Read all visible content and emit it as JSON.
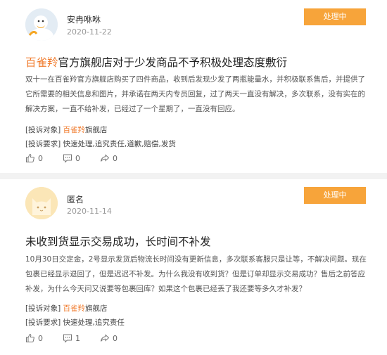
{
  "posts": [
    {
      "username": "安冉咻咻",
      "date": "2020-11-22",
      "status": "处理中",
      "title_brand": "百雀羚",
      "title_rest": "官方旗舰店对于少发商品不予积极处理态度敷衍",
      "body": "双十一在百雀羚官方旗舰店购买了四件商品，收到后发现少发了两瓶能量水，并积极联系售后，并提供了它所需要的相关信息和图片，并承诺在两天内专员回复，过了两天一直没有解决，多次联系，没有实在的解决方案，一直不给补发，已经过了一个星期了，一直没有回应。",
      "complaint_object_label": "[投诉对象]",
      "complaint_object_brand": "百雀羚",
      "complaint_object_rest": "旗舰店",
      "complaint_request_label": "[投诉要求]",
      "complaint_request": "快速处理,追究责任,道歉,赔偿,发货",
      "likes": "0",
      "comments": "0",
      "shares": "0"
    },
    {
      "username": "匿名",
      "date": "2020-11-14",
      "status": "处理中",
      "title_brand": "",
      "title_rest": "未收到货显示交易成功，长时间不补发",
      "body": "10月30日交定金，2号显示发货后物流长时间没有更新信息，多次联系客服只是让等，不解决问题。现在包裹已经显示退回了，但是迟迟不补发。为什么我没有收到货？但是订单却显示交易成功？售后之前答应补发，为什么今天问又说要等包裹回库？如果这个包裹已经丢了我还要等多久才补发？",
      "complaint_object_label": "[投诉对象]",
      "complaint_object_brand": "百雀羚",
      "complaint_object_rest": "旗舰店",
      "complaint_request_label": "[投诉要求]",
      "complaint_request": "快速处理,追究责任",
      "likes": "0",
      "comments": "1",
      "shares": "0"
    }
  ],
  "icons": {
    "avatar_1": "goose-avatar-icon",
    "avatar_2": "cat-avatar-icon",
    "like": "thumbs-up-icon",
    "comment": "comment-icon",
    "share": "share-icon"
  },
  "colors": {
    "status_bg": "#f7a43a",
    "brand_text": "#f07a2b"
  }
}
